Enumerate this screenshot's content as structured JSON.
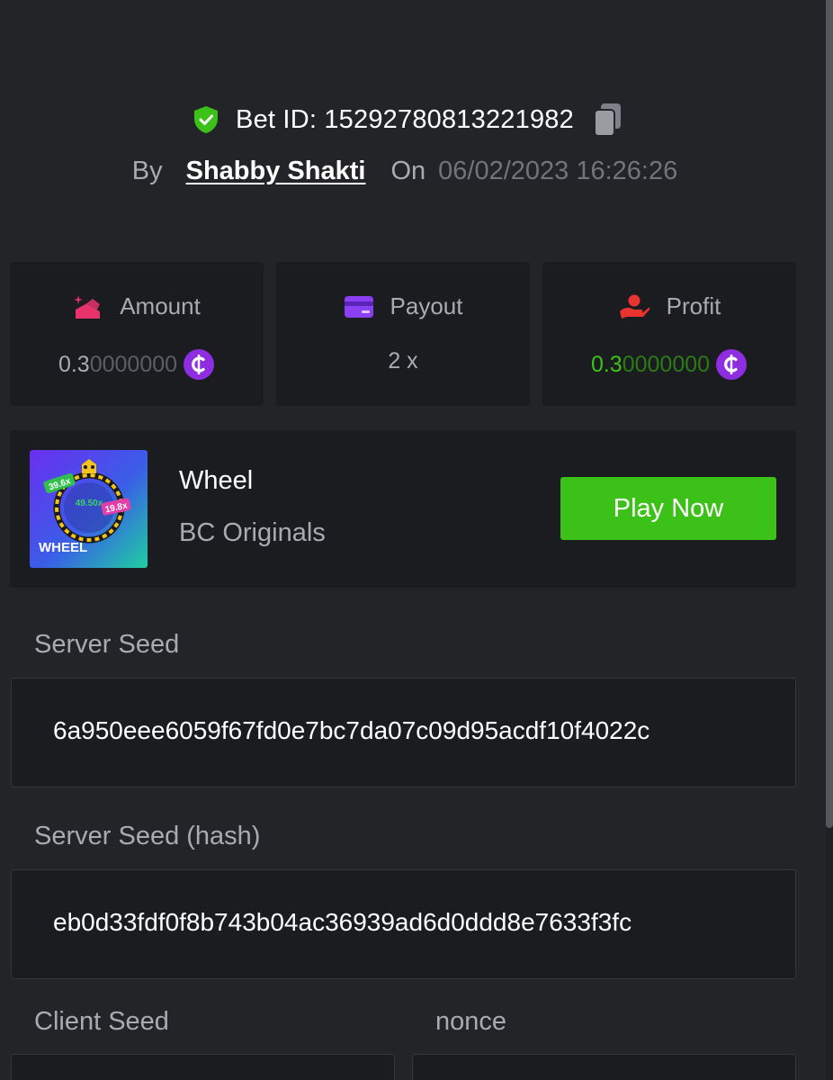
{
  "header": {
    "bet_id_label": "Bet ID: 15292780813221982",
    "by_label": "By",
    "user_name": "Shabby Shakti",
    "on_label": "On",
    "date": "06/02/2023 16:26:26"
  },
  "stats": {
    "amount": {
      "title": "Amount",
      "value_main": "0.3",
      "value_faded": "0000000"
    },
    "payout": {
      "title": "Payout",
      "value": "2 x"
    },
    "profit": {
      "title": "Profit",
      "value_main": "0.3",
      "value_faded": "0000000"
    }
  },
  "game": {
    "name": "Wheel",
    "provider": "BC Originals",
    "play_label": "Play Now",
    "thumb": {
      "title": "WHEEL",
      "chips": [
        "39.6x",
        "49.50x",
        "19.8x"
      ]
    }
  },
  "fields": {
    "server_seed": {
      "label": "Server Seed",
      "value": "6a950eee6059f67fd0e7bc7da07c09d95acdf10f4022c"
    },
    "server_seed_hash": {
      "label": "Server Seed (hash)",
      "value": "eb0d33fdf0f8b743b04ac36939ad6d0ddd8e7633f3fc"
    },
    "client_seed": {
      "label": "Client Seed"
    },
    "nonce": {
      "label": "nonce"
    }
  },
  "colors": {
    "background": "#232428",
    "card": "#1b1c20",
    "accent_green": "#3bc117",
    "coin_purple": "#8f2ee0",
    "shield_green": "#3bc117",
    "amount_icon": "#e8336a",
    "payout_icon": "#8a3ff2",
    "profit_icon": "#e8332e"
  }
}
